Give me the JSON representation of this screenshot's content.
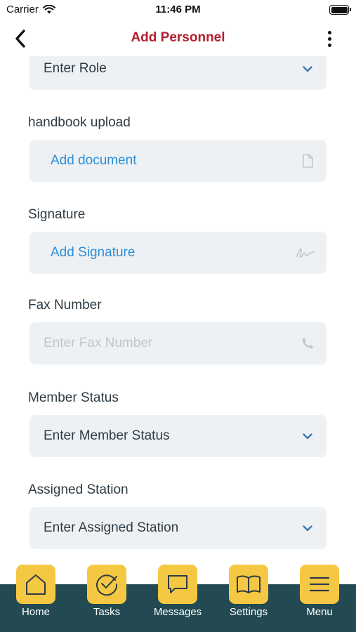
{
  "status_bar": {
    "carrier": "Carrier",
    "time": "11:46 PM"
  },
  "nav": {
    "title": "Add Personnel"
  },
  "form": {
    "role": {
      "value": "Enter Role"
    },
    "handbook": {
      "label": "handbook upload",
      "action": "Add document"
    },
    "signature": {
      "label": "Signature",
      "action": "Add Signature"
    },
    "fax": {
      "label": "Fax Number",
      "placeholder": "Enter Fax Number"
    },
    "member_status": {
      "label": "Member Status",
      "value": "Enter Member Status"
    },
    "assigned_station": {
      "label": "Assigned Station",
      "value": "Enter Assigned Station"
    }
  },
  "tabs": [
    {
      "label": "Home",
      "icon": "home-icon"
    },
    {
      "label": "Tasks",
      "icon": "check-circle-icon"
    },
    {
      "label": "Messages",
      "icon": "chat-bubble-icon"
    },
    {
      "label": "Settings",
      "icon": "book-icon"
    },
    {
      "label": "Menu",
      "icon": "hamburger-icon"
    }
  ],
  "colors": {
    "title": "#b51e30",
    "link": "#2b8fd6",
    "field_bg": "#eef1f4",
    "tab_bar": "#234a53",
    "tab_icon_bg": "#f5c844"
  }
}
